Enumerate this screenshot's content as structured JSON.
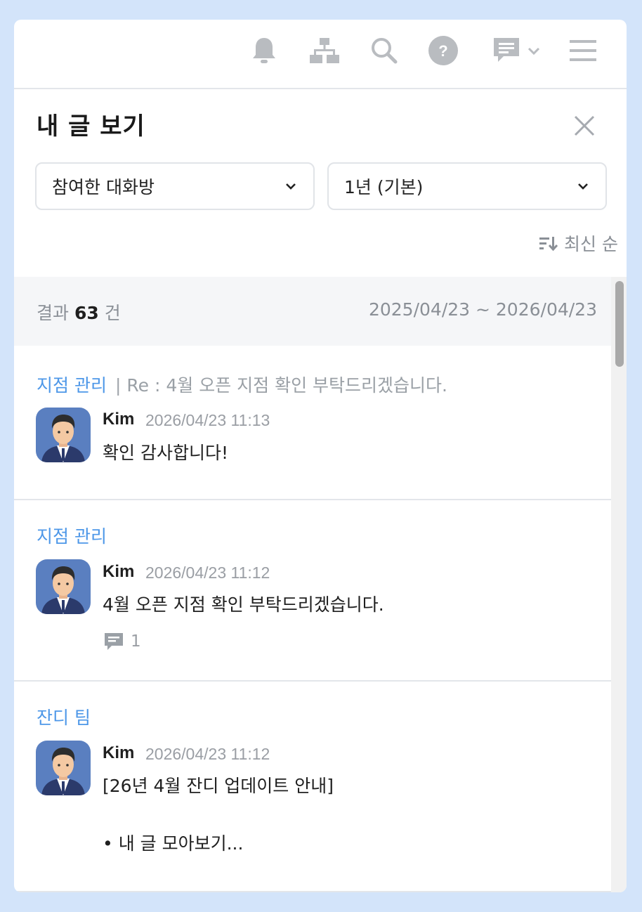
{
  "toolbar": {
    "icons": [
      "bell-icon",
      "org-chart-icon",
      "search-icon",
      "help-icon",
      "chat-icon",
      "chevron-down-icon",
      "menu-icon"
    ],
    "help_glyph": "?"
  },
  "panel": {
    "title": "내 글 보기",
    "close_icon": "close-icon"
  },
  "filters": {
    "room_select": "참여한 대화방",
    "period_select": "1년 (기본)"
  },
  "sort": {
    "label": "최신 순",
    "icon": "sort-icon"
  },
  "summary": {
    "prefix": "결과",
    "count": "63",
    "suffix": "건",
    "range": "2025/04/23 ~ 2026/04/23"
  },
  "posts": [
    {
      "room": "지점 관리",
      "separator": "|",
      "reference": "Re : 4월 오픈 지점 확인 부탁드리겠습니다.",
      "author": "Kim",
      "time": "2026/04/23 11:13",
      "message": "확인 감사합니다!"
    },
    {
      "room": "지점 관리",
      "author": "Kim",
      "time": "2026/04/23 11:12",
      "message": "4월 오픈 지점 확인 부탁드리겠습니다.",
      "reply_count": "1"
    },
    {
      "room": "잔디 팀",
      "author": "Kim",
      "time": "2026/04/23 11:12",
      "message": "[26년 4월 잔디 업데이트 안내]\n\n• 내 글 모아보기..."
    }
  ],
  "colors": {
    "background": "#d3e4fa",
    "room_link": "#4d97e8",
    "muted": "#9aa0a6",
    "icon": "#b9bcc0"
  }
}
